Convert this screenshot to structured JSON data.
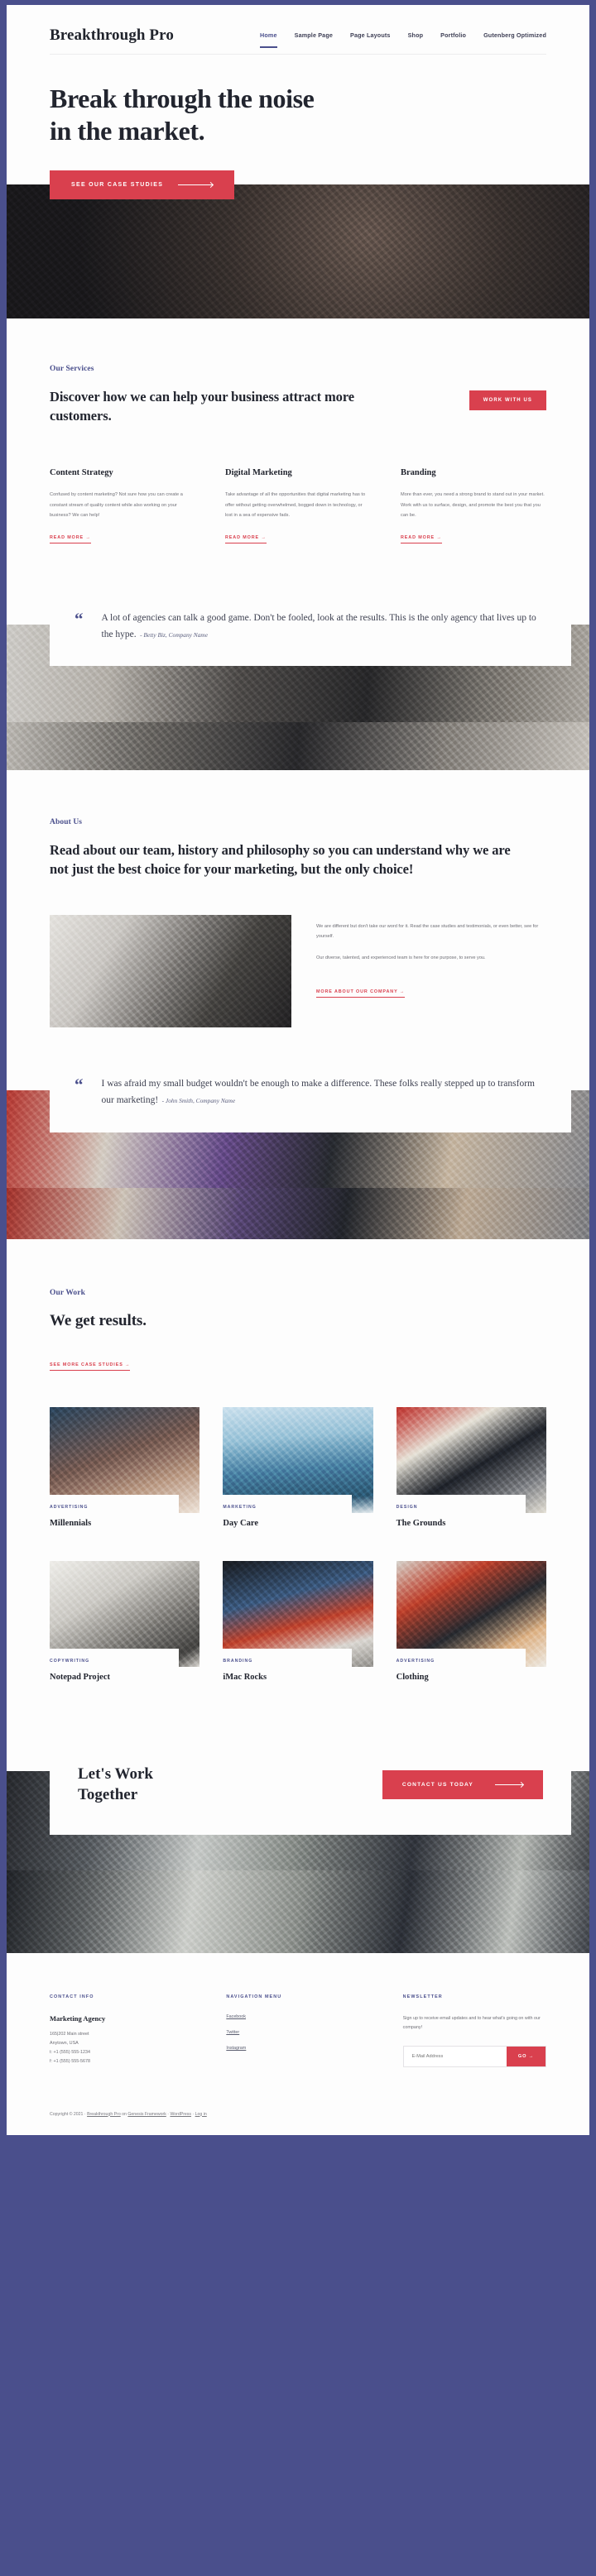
{
  "theme": {
    "accent_red": "#d9404e",
    "accent_purple": "#4a4f8c",
    "ink": "#22252f",
    "body_text": "#6e6e75",
    "page_bg": "#fdfdfd"
  },
  "header": {
    "site_title": "Breakthrough Pro",
    "nav": [
      {
        "label": "Home",
        "active": true
      },
      {
        "label": "Sample Page",
        "active": false
      },
      {
        "label": "Page Layouts",
        "active": false
      },
      {
        "label": "Shop",
        "active": false
      },
      {
        "label": "Portfolio",
        "active": false
      },
      {
        "label": "Gutenberg Optimized",
        "active": false
      }
    ]
  },
  "hero": {
    "headline_line1": "Break through the noise",
    "headline_line2": "in the market.",
    "cta_label": "See Our Case Studies"
  },
  "services": {
    "eyebrow": "Our Services",
    "title": "Discover how we can help your business attract more customers.",
    "cta_label": "Work With Us",
    "columns": [
      {
        "title": "Content Strategy",
        "body": "Confused by content marketing? Not sure how you can create a constant stream of quality content while also working on your business? We can help!",
        "link": "Read More →"
      },
      {
        "title": "Digital Marketing",
        "body": "Take advantage of all the opportunities that digital marketing has to offer without getting overwhelmed, bogged down in technology, or lost in a sea of expensive fads.",
        "link": "Read More →"
      },
      {
        "title": "Branding",
        "body": "More than ever, you need a strong brand to stand out in your market. Work with us to surface, design, and promote the best you that you can be.",
        "link": "Read More →"
      }
    ]
  },
  "testimonial_1": {
    "quote_mark": "“",
    "quote": "A lot of agencies can talk a good game. Don't be fooled, look at the results. This is the only agency that lives up to the hype.",
    "cite": "- Betty Biz, Company Name"
  },
  "about": {
    "eyebrow": "About Us",
    "title": "Read about our team, history and philosophy so you can understand why we are not just the best choice for your marketing, but the only choice!",
    "paragraph_1": "We are different but don't take our word for it. Read the case studies and testimonials, or even better, see for yourself.",
    "paragraph_2": "Our diverse, talented, and experienced team is here for one purpose, to serve you.",
    "link": "More About Our Company →"
  },
  "testimonial_2": {
    "quote_mark": "“",
    "quote": "I was afraid my small budget wouldn't be enough to make a difference. These folks really stepped up to transform our marketing!",
    "cite": "- John Smith, Company Name"
  },
  "work": {
    "eyebrow": "Our Work",
    "title": "We get results.",
    "link": "See More Case Studies →",
    "items": [
      {
        "category": "Advertising",
        "title": "Millennials"
      },
      {
        "category": "Marketing",
        "title": "Day Care"
      },
      {
        "category": "Design",
        "title": "The Grounds"
      },
      {
        "category": "Copywriting",
        "title": "Notepad Project"
      },
      {
        "category": "Branding",
        "title": "iMac Rocks"
      },
      {
        "category": "Advertising",
        "title": "Clothing"
      }
    ]
  },
  "cta": {
    "title_line1": "Let's Work",
    "title_line2": "Together",
    "button_label": "Contact Us Today"
  },
  "footer": {
    "contact": {
      "heading": "Contact Info",
      "company": "Marketing Agency",
      "lines": [
        "165|202 Main street",
        "Anytown, USA",
        "t: +1 (555) 555-1234",
        "f: +1 (555) 555-5678"
      ]
    },
    "nav_menu": {
      "heading": "Navigation Menu",
      "links": [
        "Facebook",
        "Twitter",
        "Instagram"
      ]
    },
    "newsletter": {
      "heading": "Newsletter",
      "description": "Sign up to receive email updates and to hear what's going on with our company!",
      "placeholder": "E-Mail Address",
      "button_label": "GO →"
    },
    "credits": {
      "prefix": "Copyright © 2021 · ",
      "link_1": "Breakthrough Pro",
      "mid_1": " on ",
      "link_2": "Genesis Framework",
      "mid_2": " · ",
      "link_3": "WordPress",
      "mid_3": " · ",
      "link_4": "Log in"
    }
  }
}
